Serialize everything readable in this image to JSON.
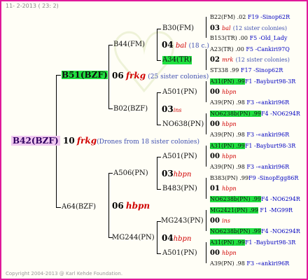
{
  "header": "11- 2-2013 ( 23: 2)",
  "footer": "Copyright 2004-2013 @ Karl Kehde Foundation.",
  "root": {
    "id": "B42(BZF)",
    "gen": "10",
    "queen": "frkg",
    "note": "(Drones from 18 sister colonies)"
  },
  "gen9": [
    {
      "id": "B51(BZF)",
      "gen": "06",
      "queen": "frkg",
      "note": "(25 sister colonies)"
    },
    {
      "id": "A64(BZF)",
      "gen": "06",
      "queen": "hbpn",
      "note": ""
    }
  ],
  "gen8": [
    {
      "id": "B44(FM)",
      "gen": "04",
      "queen": "bal",
      "note": "(18 c.)"
    },
    {
      "id": "B02(BZF)",
      "gen": "03",
      "queen": "ins",
      "note": ""
    },
    {
      "id": "A506(PN)",
      "gen": "03",
      "queen": "hbpn",
      "note": ""
    },
    {
      "id": "MG244(PN)",
      "gen": "04",
      "queen": "hbpn",
      "note": ""
    }
  ],
  "gen7": [
    {
      "id": "B30(FM)",
      "gen": "03",
      "queen": "bal",
      "note": "(12 sister colonies)"
    },
    {
      "id": "A34(TR)",
      "gen": "02",
      "queen": "mrk",
      "note": "(12 sister colonies)"
    },
    {
      "id": "A501(PN)",
      "gen": "00",
      "queen": "hbpn",
      "note": ""
    },
    {
      "id": "NO638(PN)",
      "gen": "00",
      "queen": "hbpn",
      "note": ""
    },
    {
      "id": "A501(PN)",
      "gen": "00",
      "queen": "hbpn",
      "note": ""
    },
    {
      "id": "B483(PN)",
      "gen": "01",
      "queen": "hbpn",
      "note": ""
    },
    {
      "id": "MG243(PN)",
      "gen": "00",
      "queen": "ins",
      "note": ""
    },
    {
      "id": "A501(PN)",
      "gen": "00",
      "queen": "hbpn",
      "note": ""
    }
  ],
  "gen6": [
    {
      "text": "B22(FM) .02",
      "src": "F19 -Sinop62R"
    },
    {
      "text": "B153(TR) .00",
      "src": "F5 -Old_Lady"
    },
    {
      "text": "A23(TR) .00",
      "src": "F5 -Cankiri97Q"
    },
    {
      "text": "ST338 .99",
      "src": "F17 -Sinop62R"
    },
    {
      "text": "A31(PN) .99",
      "src": "F1 -Bayburt98-3R"
    },
    {
      "text": "A39(PN) .98",
      "src": "F3 -«ankiri96R"
    },
    {
      "text": "NO6238b(PN) .99",
      "src": "F4 -NO6294R"
    },
    {
      "text": "A39(PN) .98",
      "src": "F3 -«ankiri96R"
    },
    {
      "text": "A31(PN) .99",
      "src": "F1 -Bayburt98-3R"
    },
    {
      "text": "A39(PN) .98",
      "src": "F3 -«ankiri96R"
    },
    {
      "text": "B383(PN) .99",
      "src": "F9 -SinopEgg86R"
    },
    {
      "text": "NO6238b(PN) .99",
      "src": "F4 -NO6294R"
    },
    {
      "text": "MG2421(PN) .99",
      "src": "F1 -MG99R"
    },
    {
      "text": "NO6238b(PN) .99",
      "src": "F4 -NO6294R"
    },
    {
      "text": "A31(PN) .99",
      "src": "F1 -Bayburt98-3R"
    },
    {
      "text": "A39(PN) .98",
      "src": "F3 -«ankiri96R"
    }
  ]
}
